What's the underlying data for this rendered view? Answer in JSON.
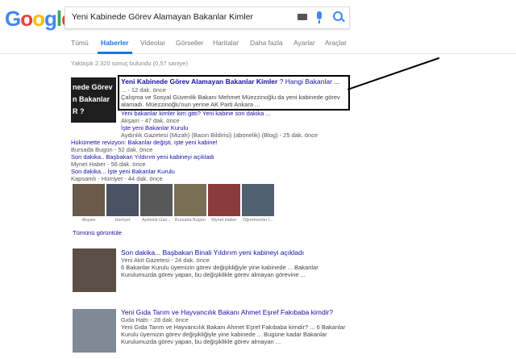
{
  "search": {
    "query": "Yeni Kabinede Görev Alamayan Bakanlar Kimler"
  },
  "tabs": [
    "Tümü",
    "Haberler",
    "Videolar",
    "Görseller",
    "Haritalar",
    "Daha fazla",
    "Ayarlar",
    "Araçlar"
  ],
  "active_tab": "Haberler",
  "result_count": "Yaklaşık 2.320 sonuç bulundu (0,57 saniye)",
  "main_result": {
    "thumb_lines": [
      "nede Görev",
      "n Bakanlar",
      "R ?"
    ],
    "title": "Yeni Kabinede Görev Alamayan Bakanlar Kimler",
    "title_tail": " ? Hangi Bakanlar ...",
    "meta": "... - 12 dak. önce",
    "snippet1": "Çalışma ve Sosyal Güvenlik Bakanı Mehmet Müezzinoğlu da yeni kabinede görev",
    "snippet2": "alamadı. Müezzinoğlu'nun yerine AK Parti Ankara ..."
  },
  "related": [
    {
      "title": "Yeni bakanlar kimler kim gitti? Yeni kabine son dakika ...",
      "meta": "Akşam - 47 dak. önce"
    },
    {
      "title": "İşte yeni Bakanlar Kurulu",
      "meta": "Aydınlık Gazetesi (Mizah) (Basın Bildirisi) (abonelik) (Blog) - 25 dak. önce"
    },
    {
      "title": "Hükümette revizyon: Bakanlar değişti, işte yeni kabine!",
      "meta": "Bursada Bugün - 52 dak. önce"
    },
    {
      "title": "Son dakika.. Başbakan Yıldırım yeni kabineyi açıkladı",
      "meta": "Mynet Haber - 56 dak. önce"
    },
    {
      "title": "Son dakika... İşte yeni Bakanlar Kurulu",
      "meta": "Kapsamlı - Hürriyet - 44 dak. önce"
    }
  ],
  "image_strip": [
    {
      "caption": "Akşam",
      "color": "#6a5a4a"
    },
    {
      "caption": "Hürriyet",
      "color": "#4a5160"
    },
    {
      "caption": "Aydınlık Gaz...",
      "color": "#585858"
    },
    {
      "caption": "Bursada Bugün",
      "color": "#7a6e55"
    },
    {
      "caption": "Mynet Haber",
      "color": "#8a3c3c"
    },
    {
      "caption": "Öğretmenler İ...",
      "color": "#506070"
    }
  ],
  "more_link": "Tümünü görüntüle",
  "card1": {
    "title": "Son dakika... Başbakan Binali Yıldırım yeni kabineyi açıkladı",
    "meta": "Yeni Akit Gazetesi - 24 dak. önce",
    "snippet1": "6 Bakanlar Kurulu üyemizin görev değişikliğiyle yine kabinede ... Bakanlar",
    "snippet2": "Kurulumuzda görev yapan, bu değişiklikle görev almayan görevine ..."
  },
  "card2": {
    "title": "Yeni Gıda Tarım ve Hayvancılık Bakanı Ahmet Eşref Fakıbaba kimdir?",
    "meta": "Gıda Hattı - 28 dak. önce",
    "snippet1": "Yeni Gıda Tarım ve Hayvancılık Bakanı Ahmet Eşref Fakıbaba kimdir? ... 6 Bakanlar",
    "snippet2": "Kurulu üyemizin görev değişikliğiyle yine kabinede ... Bugüne kadar Bakanlar",
    "snippet3": "Kurulumuzda görev yapan, bu değişiklikle görev almayan ..."
  }
}
